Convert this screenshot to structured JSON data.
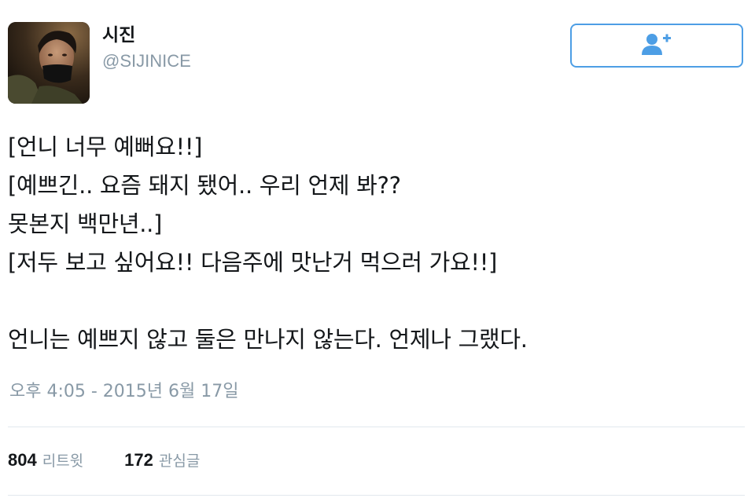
{
  "user": {
    "display_name": "시진",
    "handle": "@SIJINICE",
    "avatar_icon": "profile-photo"
  },
  "follow_button": {
    "icon": "add-user-icon",
    "accent_color": "#4d9ee5"
  },
  "tweet": {
    "lines": [
      "[언니 너무 예뻐요!!]",
      "[예쁘긴.. 요즘 돼지 됐어.. 우리 언제 봐??",
      "못본지 백만년..]",
      "[저두 보고 싶어요!! 다음주에 맛난거 먹으러 가요!!]",
      "",
      "언니는 예쁘지 않고 둘은 만나지 않는다. 언제나 그랬다."
    ],
    "timestamp": "오후 4:05 - 2015년 6월 17일"
  },
  "stats": {
    "retweets": {
      "count": "804",
      "label": "리트윗"
    },
    "likes": {
      "count": "172",
      "label": "관심글"
    }
  }
}
